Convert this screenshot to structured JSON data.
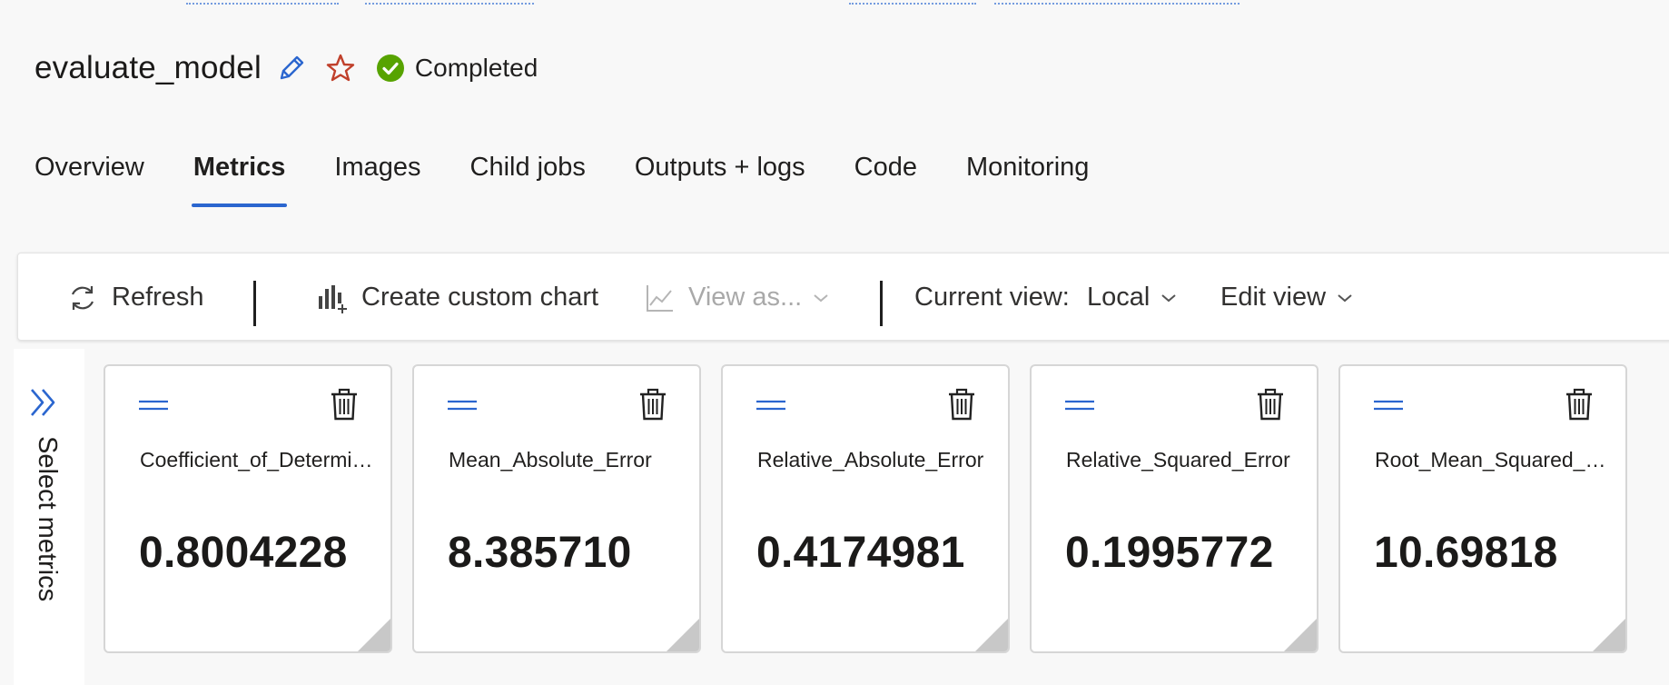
{
  "header": {
    "job_name": "evaluate_model",
    "status_text": "Completed",
    "status_icon": "check-circle-icon",
    "status_color": "#57a300"
  },
  "tabs": [
    {
      "label": "Overview"
    },
    {
      "label": "Metrics",
      "active": true
    },
    {
      "label": "Images"
    },
    {
      "label": "Child jobs"
    },
    {
      "label": "Outputs + logs"
    },
    {
      "label": "Code"
    },
    {
      "label": "Monitoring"
    }
  ],
  "toolbar": {
    "refresh_label": "Refresh",
    "create_chart_label": "Create custom chart",
    "view_as_label": "View as...",
    "current_view_label": "Current view:",
    "current_view_value": "Local",
    "edit_view_label": "Edit view"
  },
  "sidebar": {
    "select_metrics_label": "Select metrics"
  },
  "metrics": [
    {
      "name": "Coefficient_of_Determination",
      "value": "0.8004228"
    },
    {
      "name": "Mean_Absolute_Error",
      "value": "8.385710"
    },
    {
      "name": "Relative_Absolute_Error",
      "value": "0.4174981"
    },
    {
      "name": "Relative_Squared_Error",
      "value": "0.1995772"
    },
    {
      "name": "Root_Mean_Squared_Error",
      "value": "10.69818"
    }
  ],
  "colors": {
    "accent": "#2b66cf",
    "star": "#c0402b",
    "disabled_text": "#a9a9a9"
  }
}
